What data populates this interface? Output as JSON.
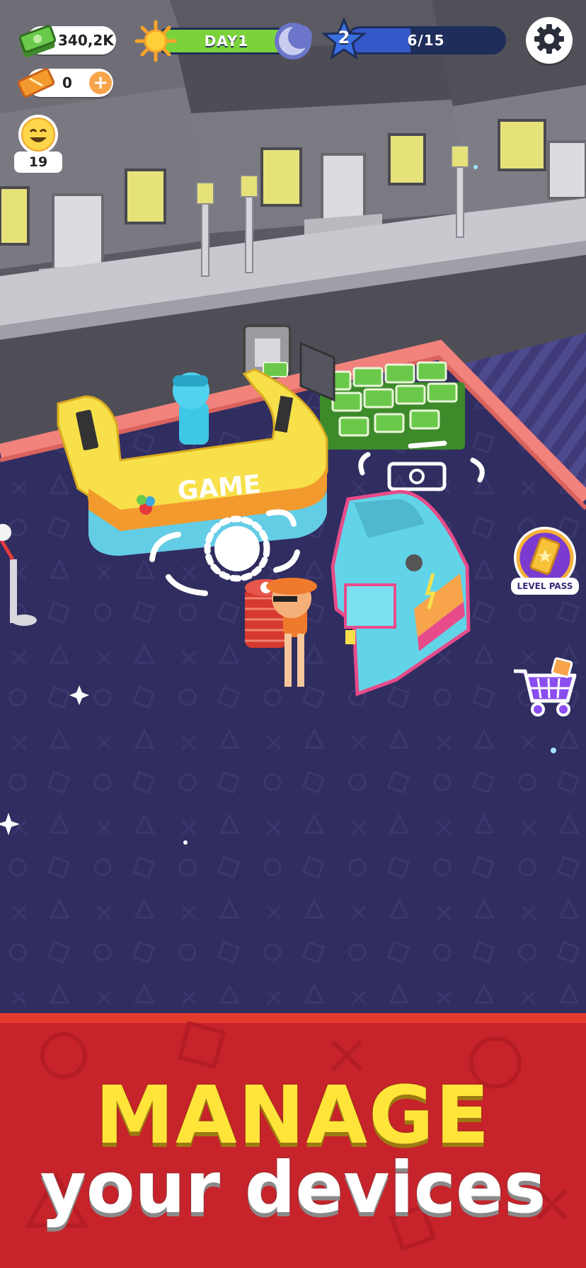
{
  "hud": {
    "cash": "340,2K",
    "tickets": "0",
    "day_label": "DAY1",
    "day_progress": 0.93,
    "level": "2",
    "level_progress_label": "6/15",
    "level_progress": 0.4,
    "customers": "19"
  },
  "side_buttons": {
    "level_pass_label": "LEVEL PASS"
  },
  "scene": {
    "counter_sign": "GAME"
  },
  "banner": {
    "line1": "MANAGE",
    "line2": "your devices"
  },
  "colors": {
    "floor": "#2f2c5e",
    "banner": "#c7232a",
    "headline_yellow": "#ffe53a",
    "day_bar": "#7cd23a",
    "level_bar": "#3558c8"
  },
  "icons": {
    "cash": "cash-stack-icon",
    "ticket": "ticket-icon",
    "add": "plus-icon",
    "sun": "sun-icon",
    "moon": "moon-icon",
    "level_star": "star-icon",
    "settings": "gear-icon",
    "customers": "smiley-icon",
    "level_pass": "level-pass-icon",
    "shop": "shopping-cart-icon"
  }
}
